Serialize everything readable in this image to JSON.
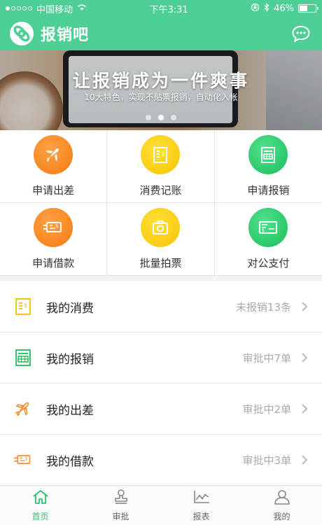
{
  "status_bar": {
    "carrier": "中国移动",
    "time": "下午3:31",
    "battery": "46%",
    "battery_level": 0.46
  },
  "header": {
    "title": "报销吧",
    "logo_icon": "link-logo-icon",
    "message_icon": "chat-bubble-icon"
  },
  "banner": {
    "title": "让报销成为一件爽事",
    "subtitle": "10大特色，实现不贴票报销，自动化入帐",
    "pages": 3,
    "active_page": 2
  },
  "quick_actions": [
    {
      "label": "申请出差",
      "icon": "airplane-icon",
      "color": "orange"
    },
    {
      "label": "消费记账",
      "icon": "receipt-icon",
      "color": "yellow"
    },
    {
      "label": "申请报销",
      "icon": "expense-form-icon",
      "color": "green"
    },
    {
      "label": "申请借款",
      "icon": "loan-card-icon",
      "color": "orange"
    },
    {
      "label": "批量拍票",
      "icon": "camera-icon",
      "color": "yellow"
    },
    {
      "label": "对公支付",
      "icon": "check-payment-icon",
      "color": "green"
    }
  ],
  "list": [
    {
      "label": "我的消费",
      "status": "未报销13条",
      "icon": "receipt-icon"
    },
    {
      "label": "我的报销",
      "status": "审批中7单",
      "icon": "expense-form-icon"
    },
    {
      "label": "我的出差",
      "status": "审批中2单",
      "icon": "airplane-icon"
    },
    {
      "label": "我的借款",
      "status": "审批中3单",
      "icon": "loan-card-icon"
    }
  ],
  "tabbar": [
    {
      "label": "首页",
      "icon": "home-icon",
      "active": true
    },
    {
      "label": "审批",
      "icon": "stamp-icon",
      "active": false
    },
    {
      "label": "报表",
      "icon": "chart-icon",
      "active": false
    },
    {
      "label": "我的",
      "icon": "user-icon",
      "active": false
    }
  ],
  "colors": {
    "brand_green": "#4dcf95",
    "orange": "#f47a12",
    "yellow": "#f7c400",
    "green": "#1dbd5c",
    "tab_active": "#2fbf72"
  }
}
